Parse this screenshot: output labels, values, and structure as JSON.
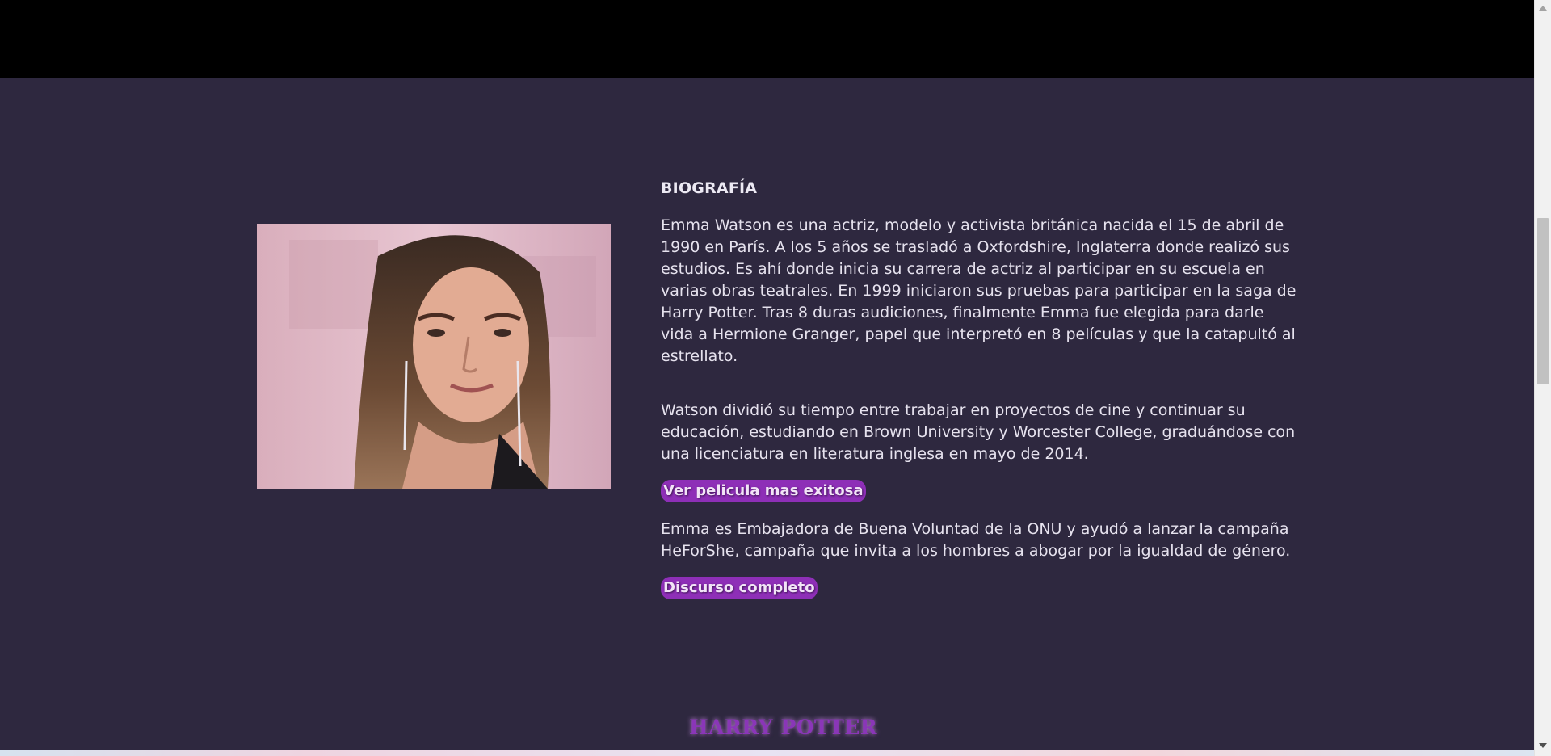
{
  "biography": {
    "title": "BIOGRAFÍA",
    "paragraph_1": "Emma Watson es una actriz, modelo y activista británica nacida el 15 de abril de 1990 en París. A los 5 años se trasladó a Oxfordshire, Inglaterra donde realizó sus estudios. Es ahí donde inicia su carrera de actriz al participar en su escuela en varias obras teatrales. En 1999 iniciaron sus pruebas para participar en la saga de Harry Potter. Tras 8 duras audiciones, finalmente Emma fue elegida para darle vida a Hermione Granger, papel que interpretó en 8 películas y que la catapultó al estrellato.",
    "paragraph_2": "Watson dividió su tiempo entre trabajar en proyectos de cine y continuar su educación, estudiando en Brown University y Worcester College, graduándose con una licenciatura en literatura inglesa en mayo de 2014.",
    "button_movie": "Ver pelicula mas exitosa",
    "paragraph_3": "Emma es Embajadora de Buena Voluntad de la ONU y ayudó a lanzar la campaña HeForShe, campaña que invita a los hombres a abogar por la igualdad de género.",
    "button_speech": "Discurso completo"
  },
  "next_section": {
    "title": "HARRY POTTER"
  },
  "colors": {
    "background": "#2e283f",
    "header": "#000000",
    "button": "#8e2fb7",
    "accent_title": "#8a36b8"
  },
  "icons": {
    "scroll_up": "scroll-up-arrow-icon",
    "scroll_down": "scroll-down-arrow-icon"
  }
}
